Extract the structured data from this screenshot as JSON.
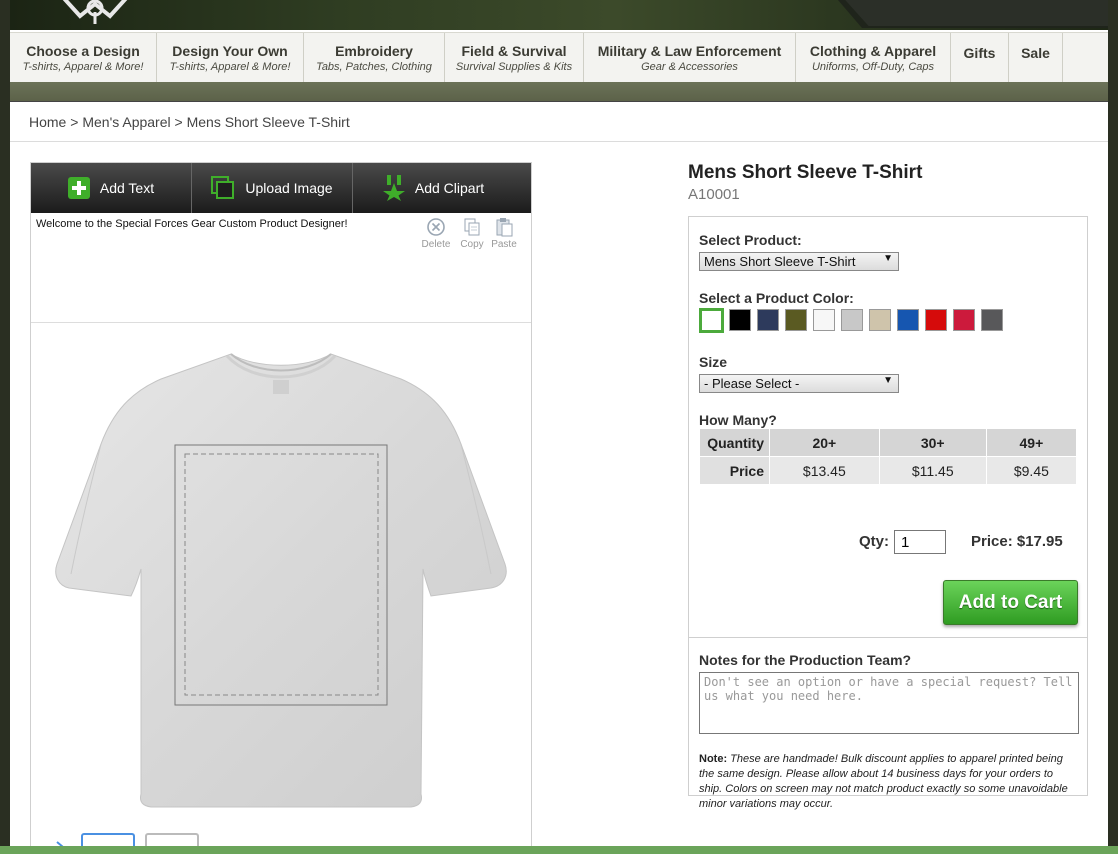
{
  "nav": {
    "items": [
      {
        "title": "Choose a Design",
        "sub": "T-shirts, Apparel & More!"
      },
      {
        "title": "Design Your Own",
        "sub": "T-shirts, Apparel & More!"
      },
      {
        "title": "Embroidery",
        "sub": "Tabs, Patches, Clothing"
      },
      {
        "title": "Field & Survival",
        "sub": "Survival Supplies & Kits"
      },
      {
        "title": "Military & Law Enforcement",
        "sub": "Gear & Accessories"
      },
      {
        "title": "Clothing & Apparel",
        "sub": "Uniforms, Off-Duty, Caps"
      },
      {
        "title": "Gifts",
        "sub": ""
      },
      {
        "title": "Sale",
        "sub": ""
      }
    ]
  },
  "breadcrumb": {
    "home": "Home",
    "sep": ">",
    "category": "Men's Apparel",
    "current": "Mens Short Sleeve T-Shirt"
  },
  "designer": {
    "add_text": "Add Text",
    "upload_image": "Upload Image",
    "add_clipart": "Add Clipart",
    "welcome": "Welcome to the Special Forces Gear Custom Product Designer!",
    "delete": "Delete",
    "copy": "Copy",
    "paste": "Paste"
  },
  "product": {
    "title": "Mens Short Sleeve T-Shirt",
    "sku": "A10001",
    "select_product_label": "Select Product:",
    "selected_product": "Mens Short Sleeve T-Shirt",
    "color_label": "Select a Product Color:",
    "colors": [
      "#ffffff",
      "#000000",
      "#2d3a5c",
      "#5a5a22",
      "#f7f7f7",
      "#c8c8c8",
      "#cfc4ab",
      "#1656b0",
      "#d60b0b",
      "#cc1a3c",
      "#58585a"
    ],
    "size_label": "Size",
    "size_value": "- Please Select -",
    "how_many_label": "How Many?",
    "pricing": {
      "quantity_label": "Quantity",
      "price_label": "Price",
      "tiers": [
        {
          "qty": "20+",
          "price": "$13.45"
        },
        {
          "qty": "30+",
          "price": "$11.45"
        },
        {
          "qty": "49+",
          "price": "$9.45"
        }
      ]
    },
    "qty_label": "Qty:",
    "qty_value": "1",
    "price_text": "Price: $17.95",
    "add_to_cart": "Add to Cart",
    "notes_label": "Notes for the Production Team?",
    "notes_placeholder": "Don't see an option or have a special request? Tell us what you need here.",
    "note_bold": "Note:",
    "note_text": "These are handmade! Bulk discount applies to apparel printed being the same design. Please allow about 14 business days for your orders to ship. Colors on screen may not match product exactly so some unavoidable minor variations may occur."
  }
}
